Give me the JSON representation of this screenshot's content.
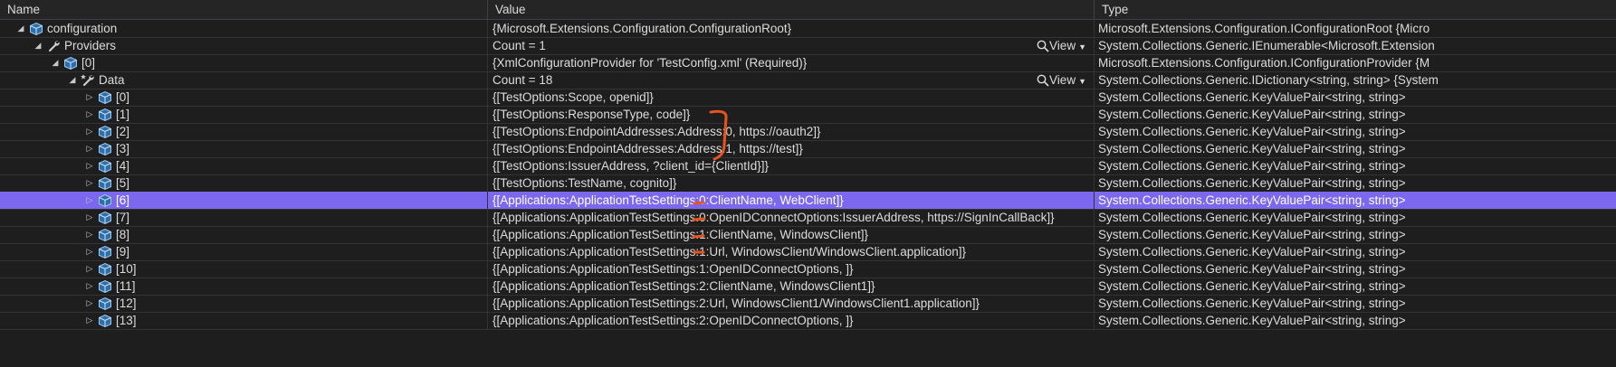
{
  "columns": {
    "name": "Name",
    "value": "Value",
    "type": "Type"
  },
  "view_label": "View",
  "rows": [
    {
      "name": "configuration",
      "value": "{Microsoft.Extensions.Configuration.ConfigurationRoot}",
      "type": "Microsoft.Extensions.Configuration.IConfigurationRoot {Micro",
      "expanded": true,
      "depth": 0,
      "icon": "object-icon"
    },
    {
      "name": "Providers",
      "value": "Count = 1",
      "type": "System.Collections.Generic.IEnumerable<Microsoft.Extension",
      "expanded": true,
      "depth": 1,
      "icon": "wrench-icon",
      "view": true
    },
    {
      "name": "[0]",
      "value": "{XmlConfigurationProvider for 'TestConfig.xml' (Required)}",
      "type": "Microsoft.Extensions.Configuration.IConfigurationProvider {M",
      "expanded": true,
      "depth": 2,
      "icon": "object-icon"
    },
    {
      "name": "Data",
      "value": "Count = 18",
      "type": "System.Collections.Generic.IDictionary<string, string> {System",
      "expanded": true,
      "depth": 3,
      "icon": "wrench-star-icon",
      "view": true
    },
    {
      "name": "[0]",
      "value": "{[TestOptions:Scope, openid]}",
      "type": "System.Collections.Generic.KeyValuePair<string, string>",
      "expanded": false,
      "depth": 4,
      "icon": "object-icon"
    },
    {
      "name": "[1]",
      "value": "{[TestOptions:ResponseType, code]}",
      "type": "System.Collections.Generic.KeyValuePair<string, string>",
      "expanded": false,
      "depth": 4,
      "icon": "object-icon"
    },
    {
      "name": "[2]",
      "value": "{[TestOptions:EndpointAddresses:Address:0, https://oauth2]}",
      "type": "System.Collections.Generic.KeyValuePair<string, string>",
      "expanded": false,
      "depth": 4,
      "icon": "object-icon"
    },
    {
      "name": "[3]",
      "value": "{[TestOptions:EndpointAddresses:Address:1, https://test]}",
      "type": "System.Collections.Generic.KeyValuePair<string, string>",
      "expanded": false,
      "depth": 4,
      "icon": "object-icon"
    },
    {
      "name": "[4]",
      "value": "{[TestOptions:IssuerAddress, ?client_id={ClientId}]}",
      "type": "System.Collections.Generic.KeyValuePair<string, string>",
      "expanded": false,
      "depth": 4,
      "icon": "object-icon"
    },
    {
      "name": "[5]",
      "value": "{[TestOptions:TestName, cognito]}",
      "type": "System.Collections.Generic.KeyValuePair<string, string>",
      "expanded": false,
      "depth": 4,
      "icon": "object-icon"
    },
    {
      "name": "[6]",
      "value": "{[Applications:ApplicationTestSettings:0:ClientName, WebClient]}",
      "type": "System.Collections.Generic.KeyValuePair<string, string>",
      "expanded": false,
      "depth": 4,
      "icon": "object-icon",
      "selected": true
    },
    {
      "name": "[7]",
      "value": "{[Applications:ApplicationTestSettings:0:OpenIDConnectOptions:IssuerAddress, https://SignInCallBack]}",
      "type": "System.Collections.Generic.KeyValuePair<string, string>",
      "expanded": false,
      "depth": 4,
      "icon": "object-icon"
    },
    {
      "name": "[8]",
      "value": "{[Applications:ApplicationTestSettings:1:ClientName, WindowsClient]}",
      "type": "System.Collections.Generic.KeyValuePair<string, string>",
      "expanded": false,
      "depth": 4,
      "icon": "object-icon"
    },
    {
      "name": "[9]",
      "value": "{[Applications:ApplicationTestSettings:1:Url, WindowsClient/WindowsClient.application]}",
      "type": "System.Collections.Generic.KeyValuePair<string, string>",
      "expanded": false,
      "depth": 4,
      "icon": "object-icon"
    },
    {
      "name": "[10]",
      "value": "{[Applications:ApplicationTestSettings:1:OpenIDConnectOptions, ]}",
      "type": "System.Collections.Generic.KeyValuePair<string, string>",
      "expanded": false,
      "depth": 4,
      "icon": "object-icon"
    },
    {
      "name": "[11]",
      "value": "{[Applications:ApplicationTestSettings:2:ClientName, WindowsClient1]}",
      "type": "System.Collections.Generic.KeyValuePair<string, string>",
      "expanded": false,
      "depth": 4,
      "icon": "object-icon"
    },
    {
      "name": "[12]",
      "value": "{[Applications:ApplicationTestSettings:2:Url, WindowsClient1/WindowsClient1.application]}",
      "type": "System.Collections.Generic.KeyValuePair<string, string>",
      "expanded": false,
      "depth": 4,
      "icon": "object-icon"
    },
    {
      "name": "[13]",
      "value": "{[Applications:ApplicationTestSettings:2:OpenIDConnectOptions, ]}",
      "type": "System.Collections.Generic.KeyValuePair<string, string>",
      "expanded": false,
      "depth": 4,
      "icon": "object-icon"
    }
  ],
  "colors": {
    "background": "#1e1e1e",
    "selection": "#7b68ee",
    "annotation": "#e8541f",
    "icon_blue": "#4f9ee3"
  }
}
